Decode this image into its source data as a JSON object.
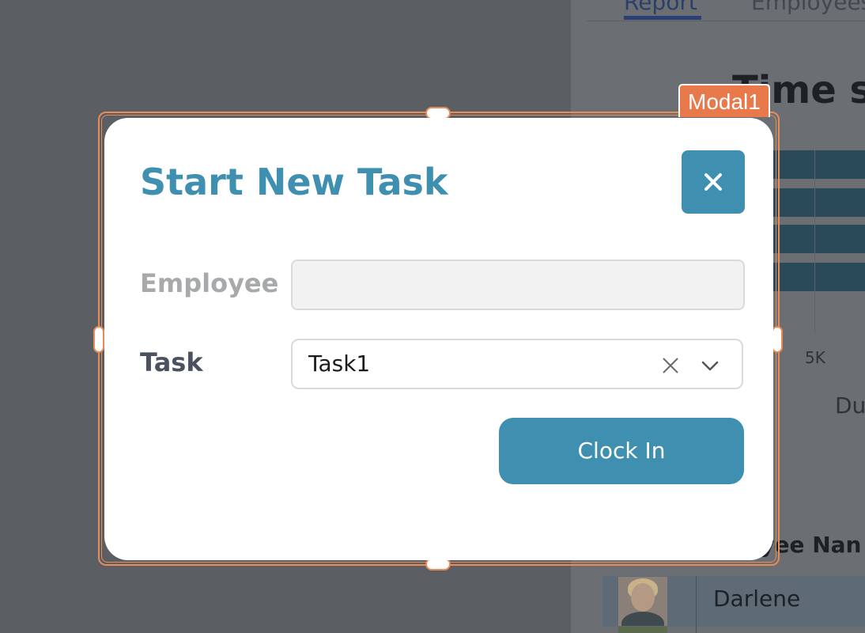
{
  "background": {
    "tabs": [
      {
        "label": "Report"
      },
      {
        "label": "Employees"
      }
    ],
    "chart_title": "Time sp",
    "tick_label": "5K",
    "axis_label": "Du",
    "column_header": "oyee Nan",
    "row_name": "Darlene"
  },
  "editor": {
    "selection_label": "Modal1",
    "selection_color": "#e8794b"
  },
  "modal": {
    "title": "Start New Task",
    "close_icon": "close-icon",
    "accent_color": "#3f8fb0",
    "fields": {
      "employee_label": "Employee",
      "employee_value": "",
      "task_label": "Task",
      "task_value": "Task1"
    },
    "submit_label": "Clock In"
  }
}
